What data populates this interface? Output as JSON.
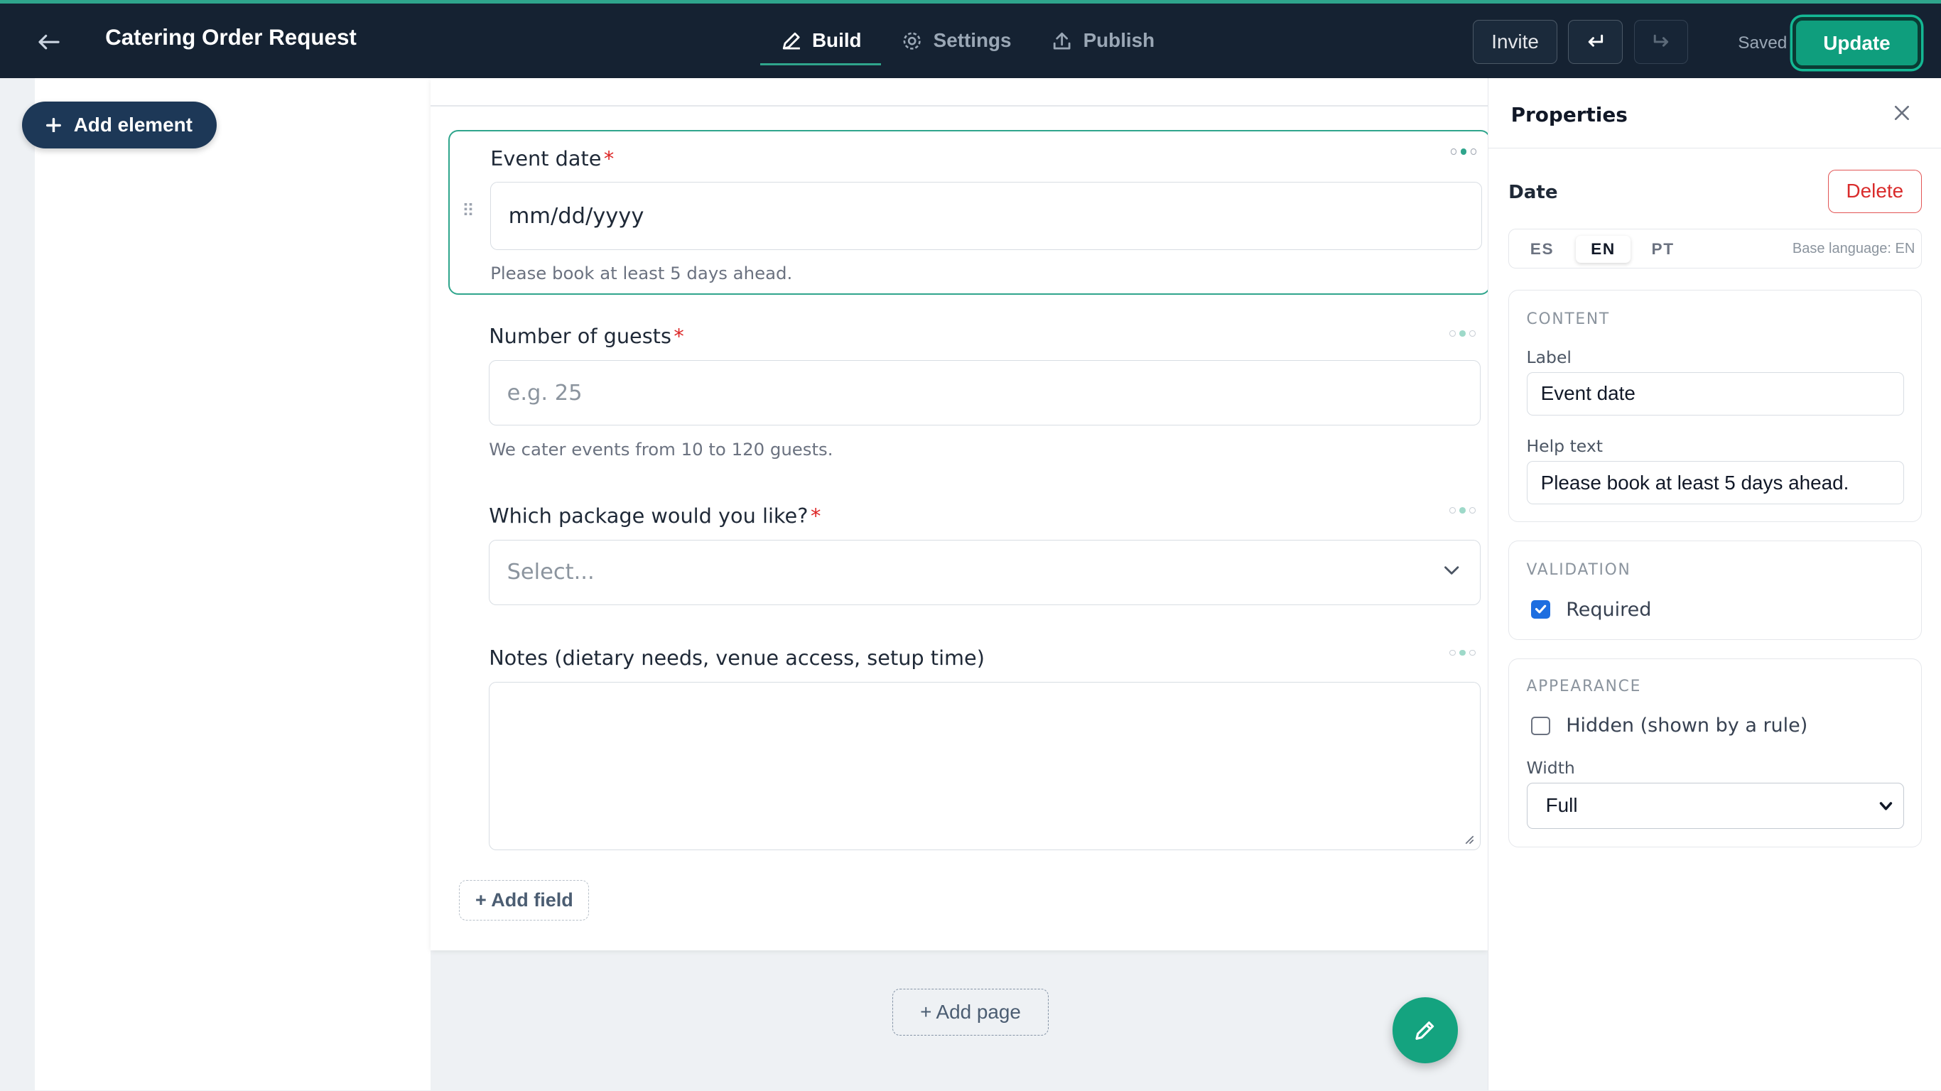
{
  "header": {
    "title": "Catering Order Request",
    "tabs": [
      {
        "label": "Build",
        "icon": "pencil-icon",
        "active": true
      },
      {
        "label": "Settings",
        "icon": "gear-icon",
        "active": false
      },
      {
        "label": "Publish",
        "icon": "upload-icon",
        "active": false
      }
    ],
    "invite_label": "Invite",
    "saved_label": "Saved",
    "update_label": "Update"
  },
  "sidebar": {
    "add_element_label": "Add element"
  },
  "form": {
    "fields": [
      {
        "label": "Event date",
        "required": true,
        "value": "mm/dd/yyyy",
        "help": "Please book at least 5 days ahead.",
        "type": "date"
      },
      {
        "label": "Number of guests",
        "required": true,
        "placeholder": "e.g. 25",
        "help": "We cater events from 10 to 120 guests.",
        "type": "number"
      },
      {
        "label": "Which package would you like?",
        "required": true,
        "placeholder": "Select...",
        "type": "select"
      },
      {
        "label": "Notes (dietary needs, venue access, setup time)",
        "required": false,
        "value": "",
        "type": "textarea"
      }
    ],
    "add_field_label": "+ Add field",
    "add_page_label": "+ Add page"
  },
  "properties": {
    "title": "Properties",
    "element_type": "Date",
    "delete_label": "Delete",
    "languages": [
      "ES",
      "EN",
      "PT"
    ],
    "active_language": "EN",
    "base_language": "Base language: EN",
    "content": {
      "title": "CONTENT",
      "label_caption": "Label",
      "label_value": "Event date",
      "help_caption": "Help text",
      "help_value": "Please book at least 5 days ahead."
    },
    "validation": {
      "title": "VALIDATION",
      "required_label": "Required",
      "required_checked": true
    },
    "appearance": {
      "title": "APPEARANCE",
      "hidden_label": "Hidden (shown by a rule)",
      "hidden_checked": false,
      "width_caption": "Width",
      "width_value": "Full"
    }
  },
  "colors": {
    "topbar": "#152232",
    "accent": "#2fa58c",
    "update_button": "#0f9e7d",
    "delete": "#d92b2b",
    "required_star": "#dc2626"
  }
}
